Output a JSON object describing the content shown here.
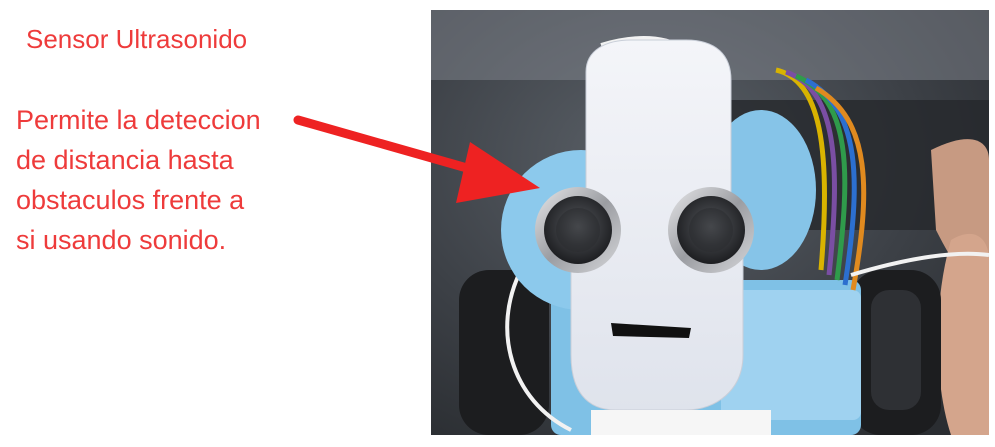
{
  "slide": {
    "title": "Sensor Ultrasonido",
    "description": "Permite la deteccion\nde distancia hasta\nobstaculos frente a\nsi usando sonido."
  },
  "photo": {
    "subject": "robot-with-ultrasonic-sensor-face"
  },
  "colors": {
    "text": "#ee3b3b",
    "arrow": "#ee2222",
    "face_plate": "#eef0f6",
    "head_blue": "#8cc9ec"
  }
}
